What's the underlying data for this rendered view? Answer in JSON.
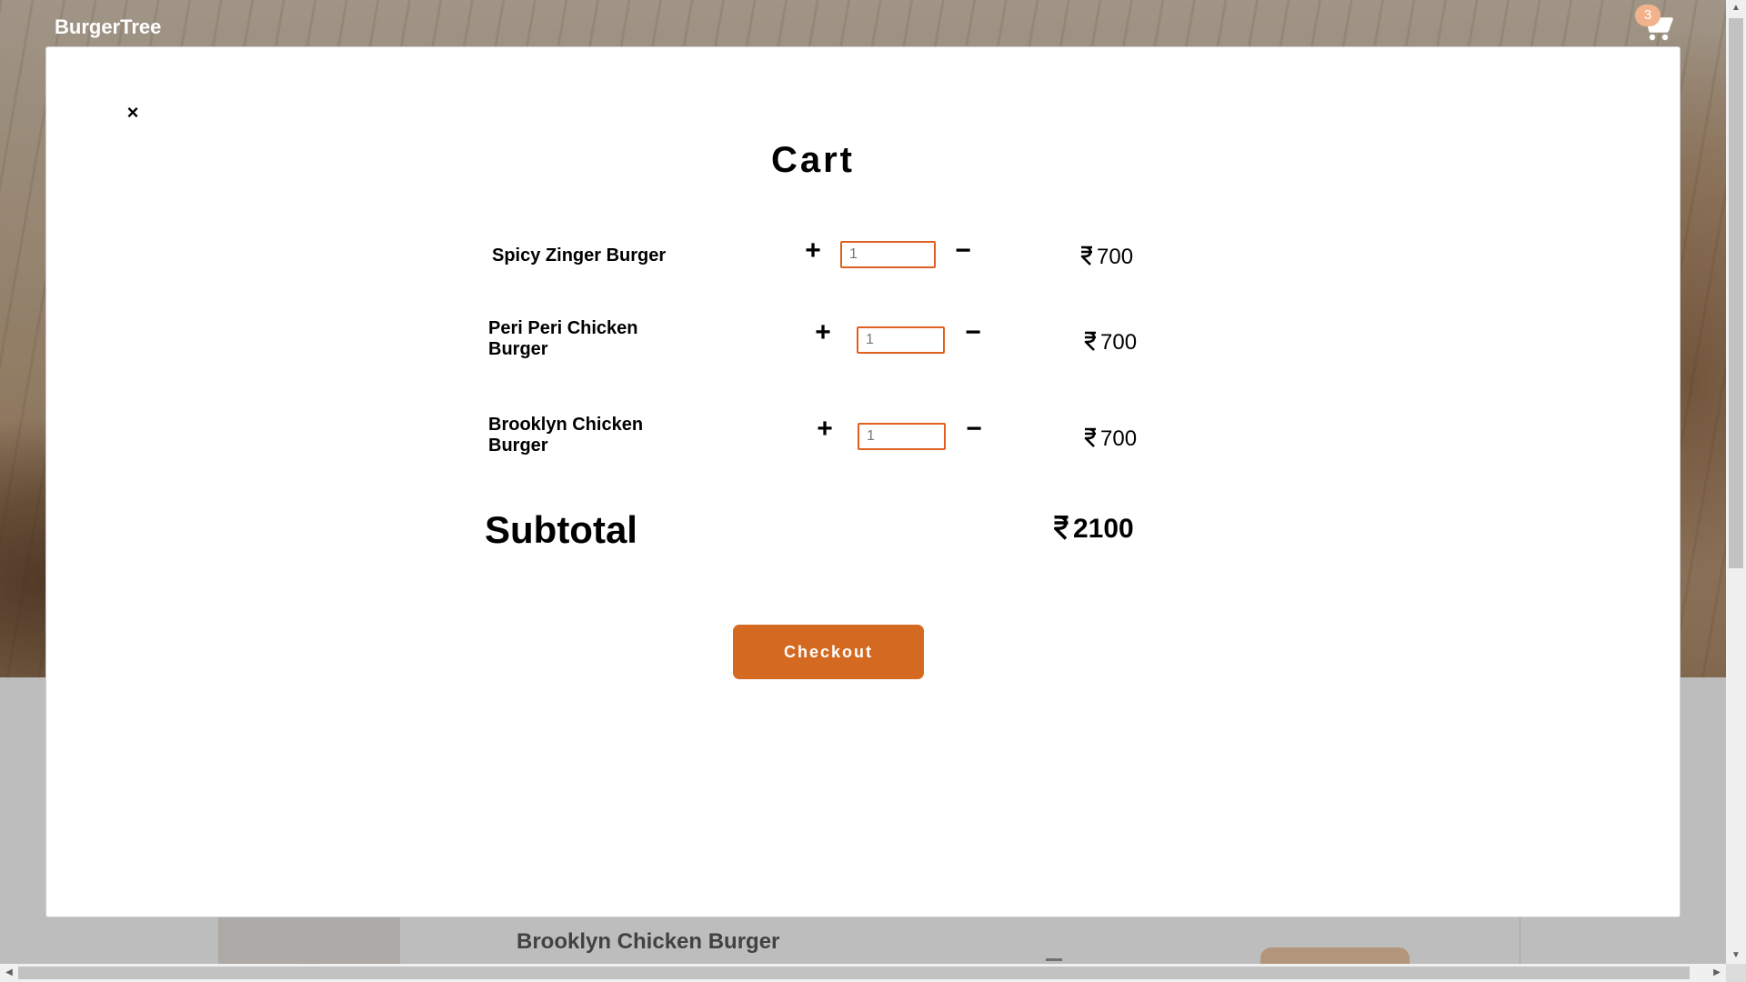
{
  "navbar": {
    "brand": "BurgerTree",
    "cart_count": "3"
  },
  "background_page": {
    "menu_item_title": "Brooklyn Chicken Burger"
  },
  "modal": {
    "close_symbol": "×",
    "title": "Cart",
    "items": [
      {
        "name": "Spicy Zinger Burger",
        "quantity": "1",
        "price": "700"
      },
      {
        "name": "Peri Peri Chicken Burger",
        "quantity": "1",
        "price": "700"
      },
      {
        "name": "Brooklyn Chicken Burger",
        "quantity": "1",
        "price": "700"
      }
    ],
    "plus_symbol": "+",
    "minus_symbol": "−",
    "subtotal_label": "Subtotal",
    "subtotal_value": "2100",
    "checkout_label": "Checkout"
  },
  "colors": {
    "accent": "#d46a21",
    "input_border": "#e0601f",
    "badge": "#f2b38c"
  },
  "icons": {
    "cart": "cart-icon",
    "currency": "rupee-icon",
    "close": "close-icon"
  }
}
